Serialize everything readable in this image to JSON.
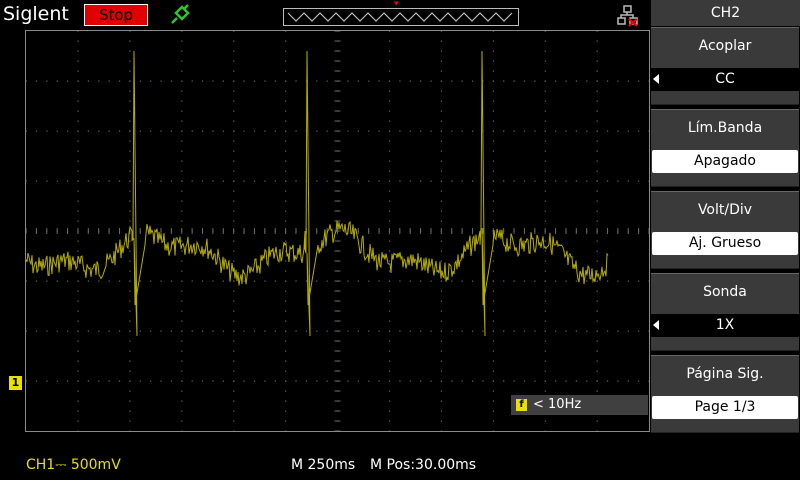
{
  "topbar": {
    "brand": "Siglent",
    "run_state": "Stop"
  },
  "screen": {
    "ch1_marker": "1",
    "trigger_badge": "f",
    "trigger_text": "< 10Hz"
  },
  "status": {
    "ch1": "CH1⎓ 500mV",
    "timebase": "M 250ms",
    "mpos": "M Pos:30.00ms"
  },
  "menu": {
    "title": "CH2",
    "items": [
      {
        "label": "Acoplar",
        "value": "CC"
      },
      {
        "label": "Lím.Banda",
        "value": "Apagado"
      },
      {
        "label": "Volt/Div",
        "value": "Aj. Grueso"
      },
      {
        "label": "Sonda",
        "value": "1X"
      },
      {
        "label": "Página Sig.",
        "value": "Page 1/3"
      }
    ]
  },
  "colors": {
    "trace": "#b5ad00",
    "ch1": "#e8e000",
    "run_stop": "#e00000",
    "menu_bg": "#3a3a3a"
  },
  "icons": [
    "probe-icon",
    "network-icon",
    "trigger-position-icon"
  ]
}
